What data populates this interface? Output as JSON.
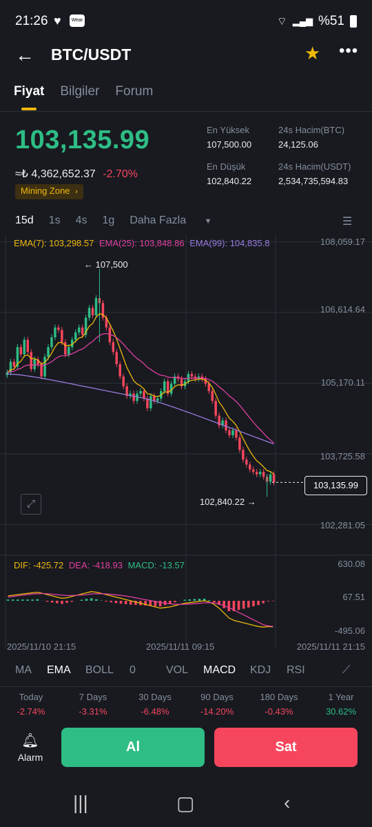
{
  "status_bar": {
    "time": "21:26",
    "battery": "%51",
    "wear": "Wear"
  },
  "header": {
    "title": "BTC/USDT"
  },
  "tabs": [
    "Fiyat",
    "Bilgiler",
    "Forum"
  ],
  "price": {
    "last": "103,135.99",
    "fiat": "≈₺ 4,362,652.37",
    "change": "-2.70%",
    "zone": "Mining Zone"
  },
  "stats": {
    "high_label": "En Yüksek",
    "high": "107,500.00",
    "vol_btc_label": "24s Hacim(BTC)",
    "vol_btc": "24,125.06",
    "low_label": "En Düşük",
    "low": "102,840.22",
    "vol_usdt_label": "24s Hacim(USDT)",
    "vol_usdt": "2,534,735,594.83"
  },
  "intervals": [
    "15d",
    "1s",
    "4s",
    "1g"
  ],
  "more_label": "Daha Fazla",
  "ema_legend": {
    "ema7": "EMA(7): 103,298.57",
    "ema25": "EMA(25): 103,848.86",
    "ema99": "EMA(99): 104,835.8"
  },
  "macd_legend": {
    "dif": "DIF: -425.72",
    "dea": "DEA: -418.93",
    "macd": "MACD: -13.57"
  },
  "price_axis": [
    "108,059.17",
    "106,614.64",
    "105,170.11",
    "103,725.58",
    "102,281.05"
  ],
  "price_tag": "103,135.99",
  "high_mark": "107,500",
  "low_mark": "102,840.22",
  "macd_axis": [
    "630.08",
    "67.51",
    "-495.06"
  ],
  "time_axis": [
    "2025/11/10 21:15",
    "2025/11/11 09:15",
    "2025/11/11 21:15"
  ],
  "indicators": [
    "MA",
    "EMA",
    "BOLL",
    "0",
    "VOL",
    "MACD",
    "KDJ",
    "RSI"
  ],
  "performance": [
    {
      "label": "Today",
      "value": "-2.74%"
    },
    {
      "label": "7 Days",
      "value": "-3.31%"
    },
    {
      "label": "30 Days",
      "value": "-6.48%"
    },
    {
      "label": "90 Days",
      "value": "-14.20%"
    },
    {
      "label": "180 Days",
      "value": "-0.43%"
    },
    {
      "label": "1 Year",
      "value": "30.62%"
    }
  ],
  "actions": {
    "alarm": "Alarm",
    "buy": "Al",
    "sell": "Sat"
  },
  "colors": {
    "up": "#2ebd85",
    "down": "#f6465d",
    "accent": "#f0b90b",
    "ema7": "#f0b90b",
    "ema25": "#e040a0",
    "ema99": "#9b7be0"
  },
  "chart_data": {
    "type": "candlestick",
    "title": "BTC/USDT 15d",
    "ylim": [
      102281.05,
      108059.17
    ],
    "x_labels": [
      "2025/11/10 21:15",
      "2025/11/11 09:15",
      "2025/11/11 21:15"
    ],
    "close": [
      105380,
      105600,
      105500,
      105900,
      105750,
      106050,
      105800,
      105450,
      105650,
      105550,
      105300,
      105700,
      105900,
      106100,
      106300,
      106250,
      106000,
      105750,
      105900,
      106050,
      106200,
      106300,
      106150,
      106500,
      106700,
      106550,
      106900,
      106800,
      106500,
      106300,
      106000,
      105800,
      105550,
      105300,
      105100,
      104900,
      104950,
      104800,
      104950,
      105000,
      104850,
      104650,
      104900,
      104800,
      104850,
      105000,
      105200,
      104950,
      105150,
      105300,
      105250,
      105100,
      105200,
      105350,
      105300,
      105250,
      105300,
      105250,
      105150,
      105000,
      104800,
      104500,
      104300,
      104400,
      104200,
      104100,
      104200,
      104050,
      103800,
      103600,
      103500,
      103400,
      103350,
      103300,
      103350,
      103250,
      103150,
      103300,
      103136
    ],
    "high_marked": 107500,
    "low_marked": 102840.22,
    "macd_ylim": [
      -495.06,
      630.08
    ],
    "dif": [
      80,
      90,
      100,
      110,
      120,
      130,
      140,
      120,
      100,
      80,
      60,
      40,
      50,
      70,
      90,
      110,
      130,
      150,
      140,
      120,
      100,
      80,
      60,
      40,
      20,
      0,
      -20,
      -40,
      -60,
      -80,
      -100,
      -120,
      -110,
      -100,
      -80,
      -60,
      -40,
      -30,
      -20,
      -10,
      0,
      -20,
      -60,
      -120,
      -200,
      -280,
      -320,
      -340,
      -360,
      -380,
      -400,
      -420,
      -430,
      -420,
      -426
    ],
    "dea": [
      60,
      70,
      80,
      90,
      100,
      110,
      115,
      118,
      115,
      108,
      100,
      92,
      85,
      85,
      90,
      95,
      100,
      110,
      115,
      115,
      112,
      105,
      98,
      88,
      76,
      63,
      48,
      33,
      18,
      3,
      -12,
      -28,
      -40,
      -50,
      -56,
      -58,
      -57,
      -53,
      -48,
      -42,
      -34,
      -30,
      -36,
      -52,
      -80,
      -110,
      -150,
      -190,
      -230,
      -270,
      -310,
      -350,
      -390,
      -410,
      -419
    ],
    "hist": [
      20,
      20,
      20,
      20,
      20,
      20,
      25,
      2,
      -15,
      -28,
      -40,
      -52,
      -35,
      -15,
      0,
      15,
      30,
      40,
      25,
      5,
      -12,
      -25,
      -38,
      -48,
      -56,
      -63,
      -68,
      -73,
      -78,
      -83,
      -88,
      -92,
      -70,
      -50,
      -24,
      -2,
      17,
      23,
      28,
      32,
      34,
      10,
      -24,
      -68,
      -120,
      -170,
      -170,
      -150,
      -130,
      -110,
      -90,
      -70,
      -40,
      -10,
      -7
    ]
  }
}
